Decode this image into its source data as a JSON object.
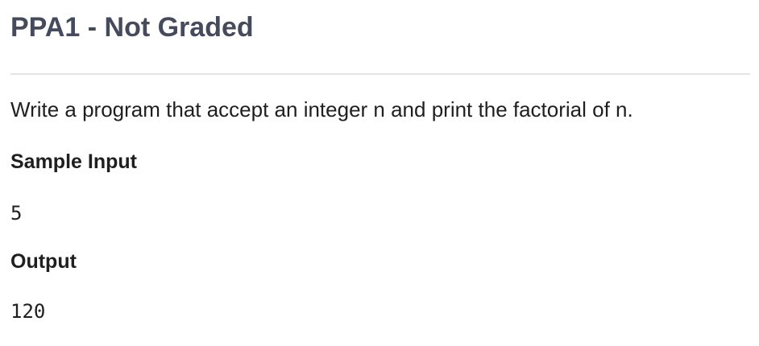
{
  "problem": {
    "title": "PPA1 - Not Graded",
    "description": "Write a program that accept an integer n and print the factorial of n.",
    "sample_input_heading": "Sample Input",
    "sample_input_value": "5",
    "output_heading": "Output",
    "output_value": "120"
  },
  "colors": {
    "title": "#454b5c",
    "text": "#1f1f1f",
    "divider": "#e3e4e7",
    "background": "#ffffff"
  }
}
